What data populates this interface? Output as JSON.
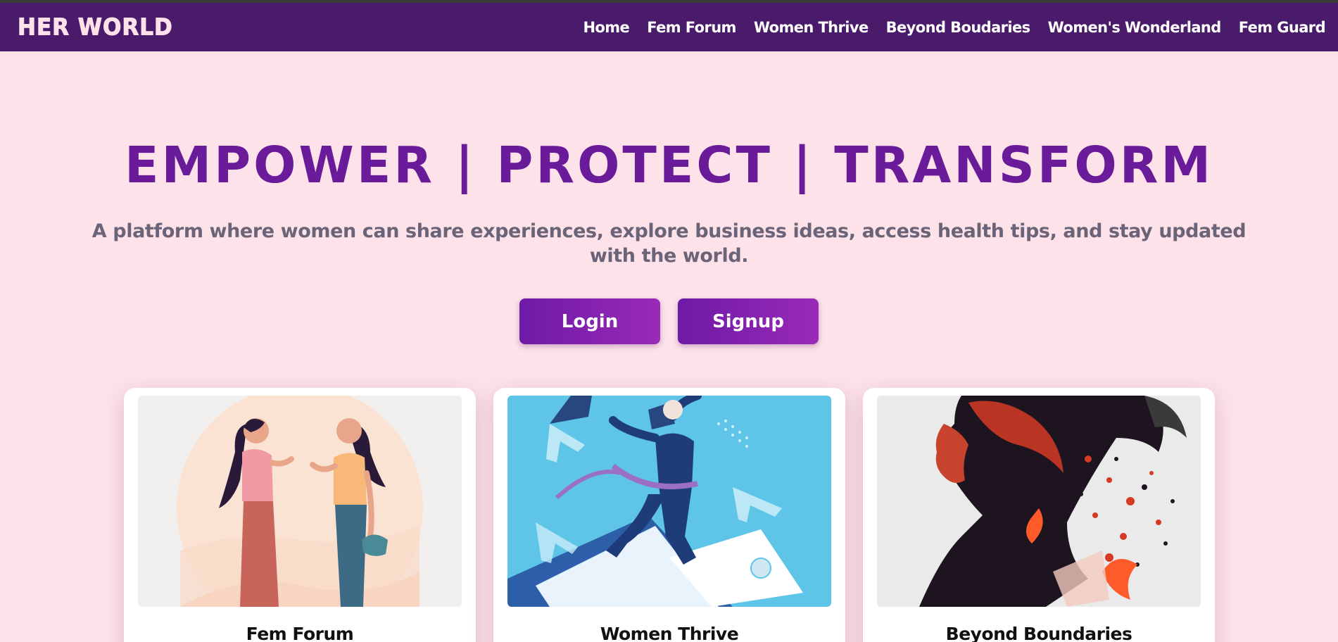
{
  "brand": {
    "logo": "HER WORLD"
  },
  "nav": {
    "items": [
      {
        "label": "Home"
      },
      {
        "label": "Fem Forum"
      },
      {
        "label": "Women Thrive"
      },
      {
        "label": "Beyond Boudaries"
      },
      {
        "label": "Women's Wonderland"
      },
      {
        "label": "Fem Guard"
      }
    ]
  },
  "hero": {
    "title": "EMPOWER | PROTECT | TRANSFORM",
    "subtitle": "A platform where women can share experiences, explore business ideas, access health tips, and stay updated with the world.",
    "login_label": "Login",
    "signup_label": "Signup"
  },
  "cards": [
    {
      "title": "Fem Forum",
      "image": "two-women-conversation-illustration"
    },
    {
      "title": "Women Thrive",
      "image": "businesswoman-leaping-illustration"
    },
    {
      "title": "Beyond Boundaries",
      "image": "woman-profile-abstract-illustration"
    }
  ],
  "colors": {
    "background": "#fde2e9",
    "navbar": "#4a1a6b",
    "title": "#6a1b9a",
    "subtitle": "#6b6478",
    "button_start": "#6d1aa6",
    "button_end": "#9a2ab8"
  }
}
